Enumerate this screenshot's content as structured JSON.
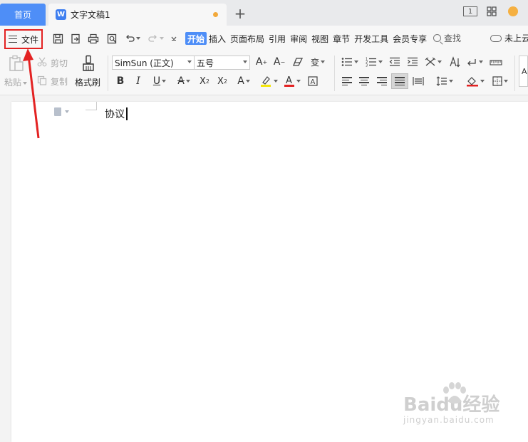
{
  "tabbar": {
    "home_label": "首页",
    "doc_icon": "W",
    "doc_title": "文字文稿1",
    "new_tab_label": "+",
    "window_icons": [
      "layout-1-icon",
      "grid-icon",
      "avatar-icon"
    ],
    "layout_badge": "1"
  },
  "menu": {
    "file_label": "文件",
    "quick_access": [
      "save-icon",
      "export-pdf-icon",
      "print-icon",
      "print-preview-icon",
      "undo-icon",
      "redo-icon",
      "customize-icon"
    ],
    "tabs": [
      {
        "label": "开始",
        "active": true
      },
      {
        "label": "插入",
        "active": false
      },
      {
        "label": "页面布局",
        "active": false
      },
      {
        "label": "引用",
        "active": false
      },
      {
        "label": "审阅",
        "active": false
      },
      {
        "label": "视图",
        "active": false
      },
      {
        "label": "章节",
        "active": false
      },
      {
        "label": "开发工具",
        "active": false
      },
      {
        "label": "会员专享",
        "active": false
      }
    ],
    "search_label": "查找",
    "cloud_label": "未上云"
  },
  "ribbon": {
    "paste_label": "粘贴",
    "cut_label": "剪切",
    "copy_label": "复制",
    "format_painter_label": "格式刷",
    "font_name": "SimSun (正文)",
    "font_size": "五号",
    "partial_style_label": "A"
  },
  "document": {
    "text": "协议"
  },
  "watermark": {
    "main": "Baidu经验",
    "sub": "jingyan.baidu.com"
  },
  "colors": {
    "accent": "#4e8ef7",
    "highlight_box": "#e32222",
    "font_color": "#e32222",
    "highlight_color": "#f5e60a"
  }
}
